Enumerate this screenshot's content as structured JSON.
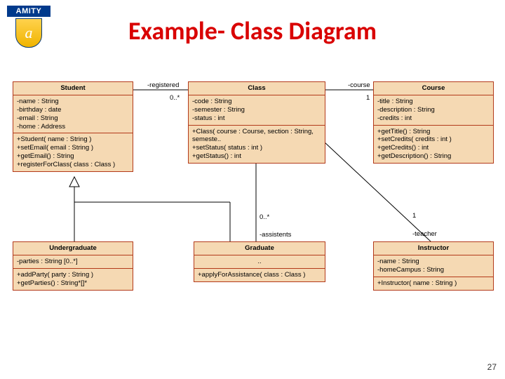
{
  "logo": {
    "text": "AMITY",
    "glyph": "a"
  },
  "title": "Example- Class Diagram",
  "page_number": "27",
  "classes": {
    "student": {
      "name": "Student",
      "attrs": [
        "-name : String",
        "-birthday : date",
        "-email : String",
        "-home : Address"
      ],
      "ops": [
        "+Student( name : String )",
        "+setEmail( email : String )",
        "+getEmail() : String",
        "+registerForClass( class : Class )"
      ]
    },
    "class": {
      "name": "Class",
      "attrs": [
        "-code : String",
        "-semester : String",
        "-status : int"
      ],
      "ops": [
        "+Class( course : Course, section : String, semeste..",
        "+setStatus( status : int )",
        "+getStatus() : int"
      ]
    },
    "course": {
      "name": "Course",
      "attrs": [
        "-title : String",
        "-description : String",
        "-credits : int"
      ],
      "ops": [
        "+getTitle() : String",
        "+setCredits( credits : int )",
        "+getCredits() : int",
        "+getDescription() : String"
      ]
    },
    "undergraduate": {
      "name": "Undergraduate",
      "attrs": [
        "-parties : String [0..*]"
      ],
      "ops": [
        "+addParty( party : String )",
        "+getParties() : String*[]*"
      ]
    },
    "graduate": {
      "name": "Graduate",
      "attrs": [
        ".."
      ],
      "ops": [
        "+applyForAssistance( class : Class )"
      ]
    },
    "instructor": {
      "name": "Instructor",
      "attrs": [
        "-name : String",
        "-homeCampus : String"
      ],
      "ops": [
        "+Instructor( name : String )"
      ]
    }
  },
  "assoc": {
    "registered": {
      "label": "-registered",
      "mult": "0..*"
    },
    "course": {
      "label": "-course",
      "mult": "1"
    },
    "assistents": {
      "label": "-assistents",
      "mult": "0..*"
    },
    "teacher": {
      "label": "-teacher",
      "mult": "1"
    }
  }
}
